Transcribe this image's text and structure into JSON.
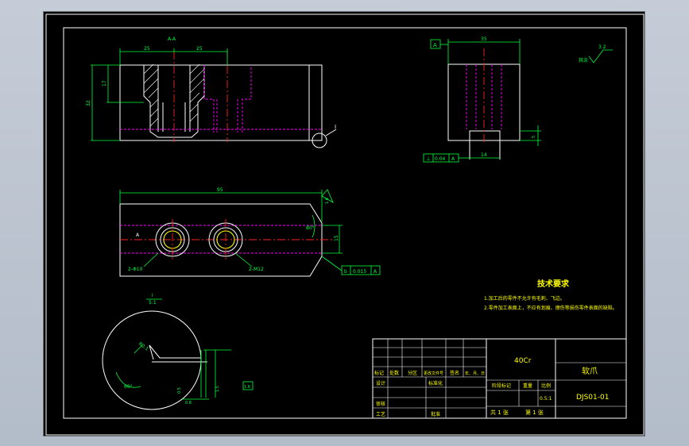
{
  "colors": {
    "background": "#000000",
    "outline": "#ffffff",
    "dimension": "#00ff3c",
    "centerline": "#ff2020",
    "hidden": "#ff00ff",
    "title_text": "#ffff00"
  },
  "front_view": {
    "section_label": "A-A",
    "dim_left": "25",
    "dim_right": "25",
    "dim_height_inner": "17",
    "dim_height_total": "32",
    "detail_ref": "I"
  },
  "side_view": {
    "datum": "A",
    "dim_width": "35",
    "dim_slot": "14",
    "dim_slot_depth": "5",
    "tol_symbol": "⊥",
    "tol_value": "0.04",
    "tol_datum": "A",
    "roughness_text": "其余",
    "roughness_value": "3.2"
  },
  "top_view": {
    "dim_length": "95",
    "dim_depth": "15",
    "angle": "80°",
    "roughness_value": "1.6",
    "hole_label_1": "2-Φ10",
    "hole_label_2": "2-M12",
    "tol_value": "0.015",
    "tol_datum": "A",
    "tol_box_symbol": "b",
    "section_mark": "A"
  },
  "detail_view": {
    "label": "I",
    "scale": "5:1",
    "dim_radius": "R0.1",
    "dim_angle": "60°",
    "dim_a": "0.5",
    "dim_b": "1.5",
    "dim_c": "1.6",
    "dim_d": "0.8"
  },
  "technical_requirements": {
    "title": "技术要求",
    "items": [
      "1.加工后的零件不允许有毛刺、飞边。",
      "2.零件加工表面上，不应有划痕、擦伤等损伤零件表面的缺陷。"
    ]
  },
  "title_block": {
    "material": "40Cr",
    "part_name": "软爪",
    "drawing_no": "DJS01-01",
    "row_labels": [
      "标记",
      "处数",
      "分区",
      "更改文件号",
      "签名",
      "年、月、日"
    ],
    "designer_label": "设计",
    "standard_label": "标准化",
    "checker_label": "审核",
    "process_label": "工艺",
    "approve_label": "批准",
    "stage_label": "阶段标记",
    "weight_label": "重量",
    "scale_label": "比例",
    "scale_value": "0.5:1",
    "sheet_total": "共 1 张",
    "sheet_no": "第 1 张"
  }
}
